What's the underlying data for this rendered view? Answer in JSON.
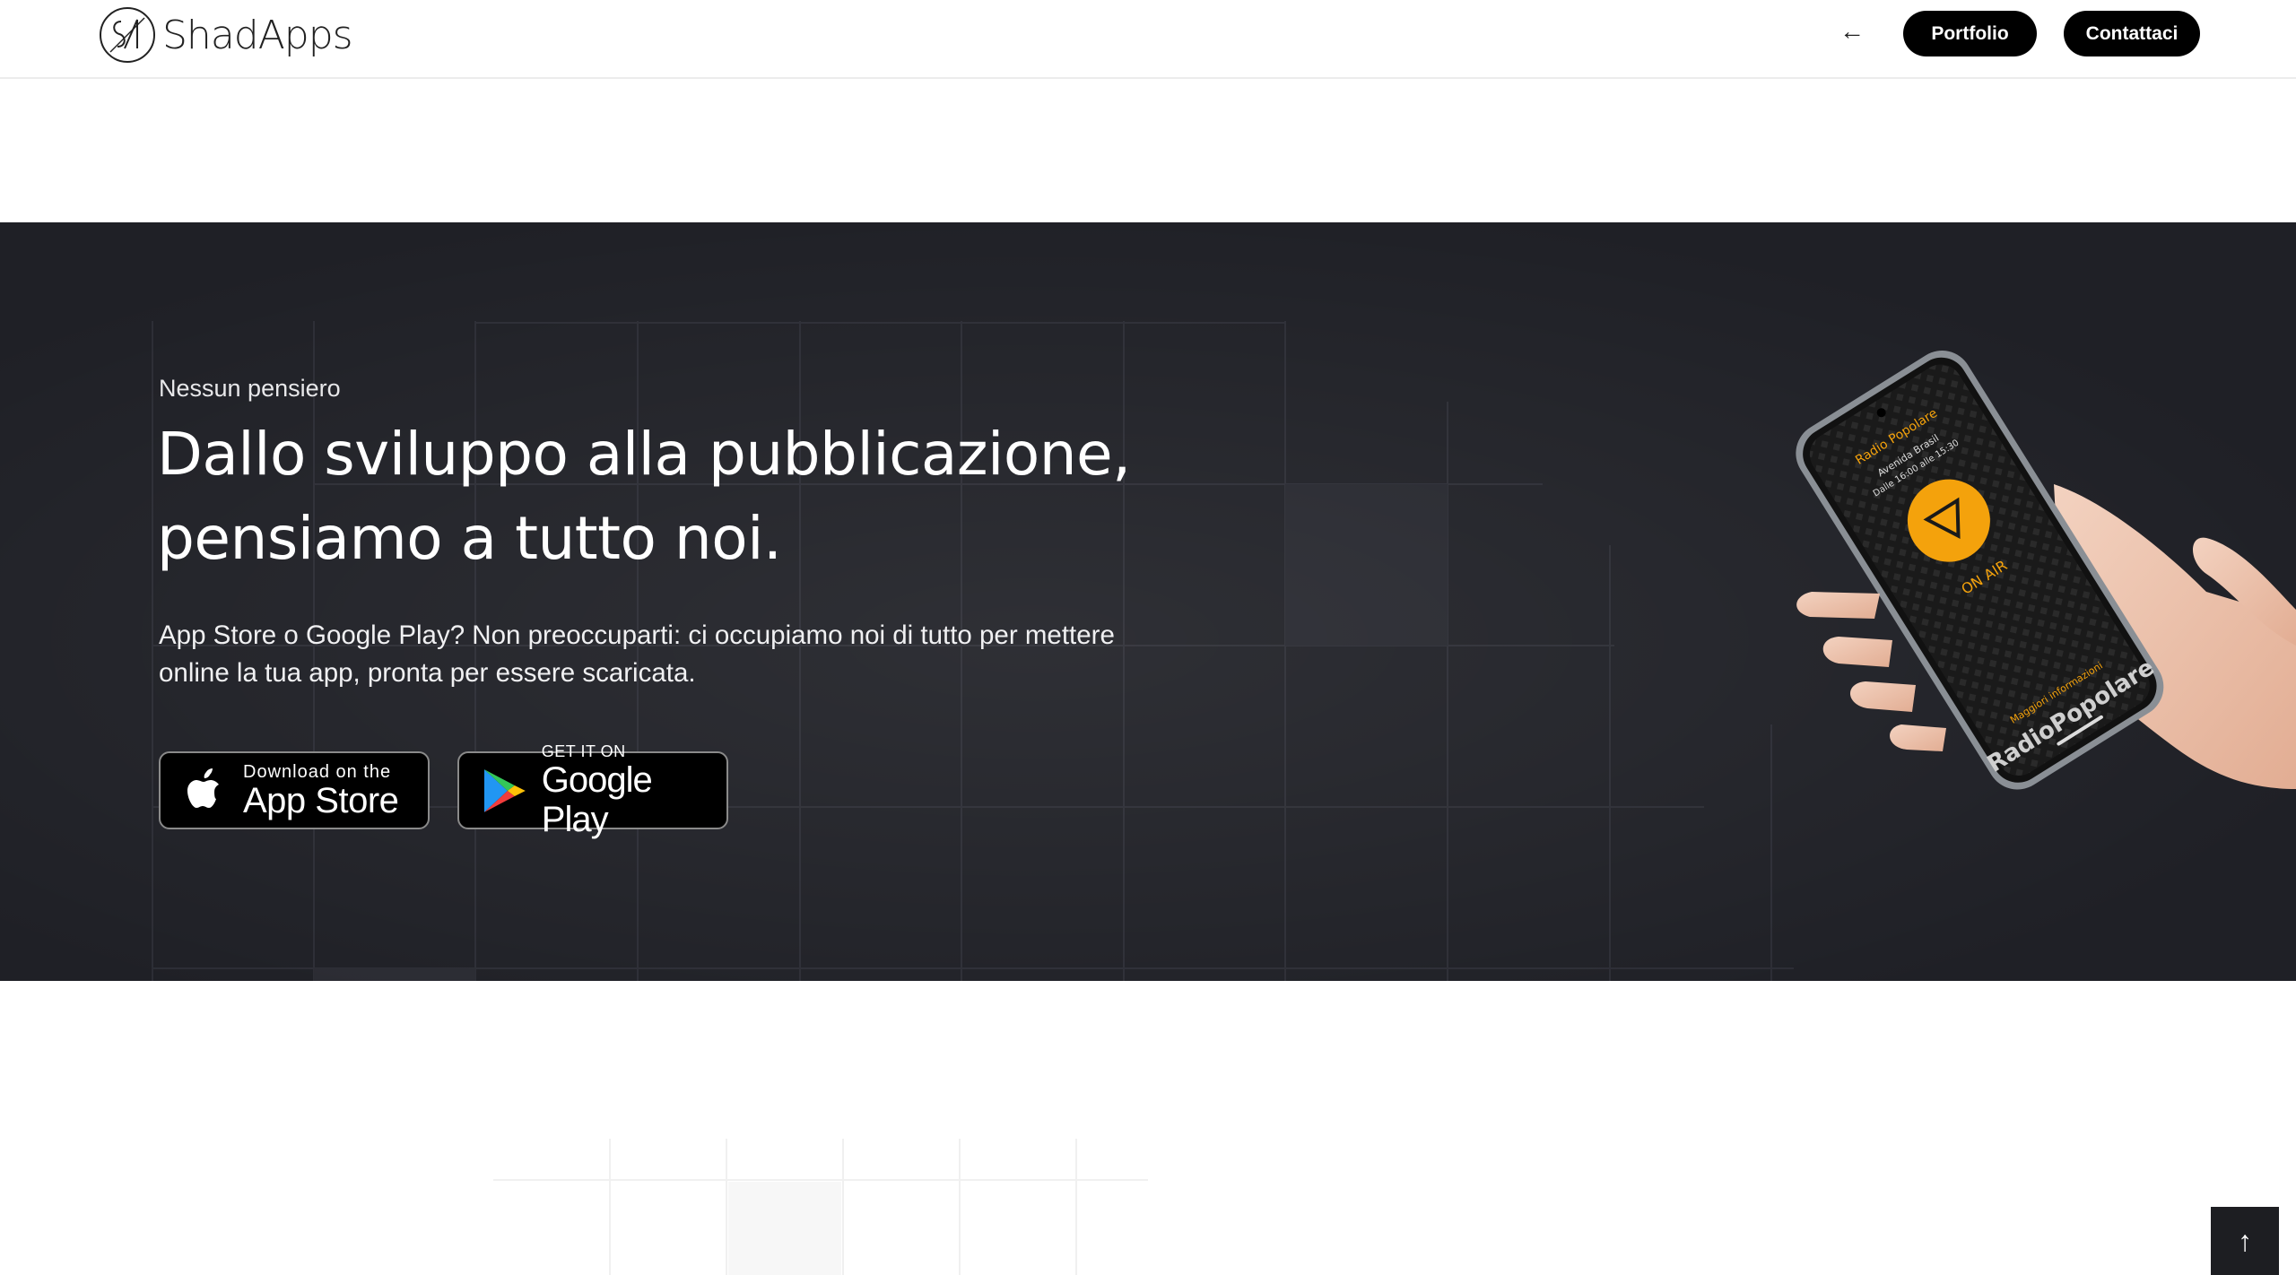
{
  "header": {
    "logo_text": "ShadApps",
    "back_icon": "arrow-left-icon",
    "nav": {
      "portfolio_label": "Portfolio",
      "contact_label": "Contattaci"
    }
  },
  "hero": {
    "eyebrow": "Nessun pensiero",
    "headline_line1": "Dallo sviluppo alla pubblicazione,",
    "headline_line2": "pensiamo a tutto noi.",
    "lead_line1": "App Store o Google Play? Non preoccuparti: ci occupiamo noi di tutto per mettere",
    "lead_line2": "online la tua app, pronta per essere scaricata.",
    "app_store": {
      "small": "Download on the",
      "big": "App Store"
    },
    "google_play": {
      "small": "GET IT ON",
      "big": "Google Play"
    },
    "phone_screen": {
      "station": "Radio Popolare",
      "show": "Avenida Brasil",
      "time": "Dalle 16:00 alle 15:30",
      "status": "ON AIR",
      "more_info": "Maggiori informazioni",
      "brand": "RadioPopolare"
    }
  },
  "scroll_top_icon": "arrow-up-icon",
  "colors": {
    "dark_band": "#1f2026",
    "accent_orange": "#f4a20c",
    "button_black": "#000000",
    "header_bg": "#ffffff"
  }
}
